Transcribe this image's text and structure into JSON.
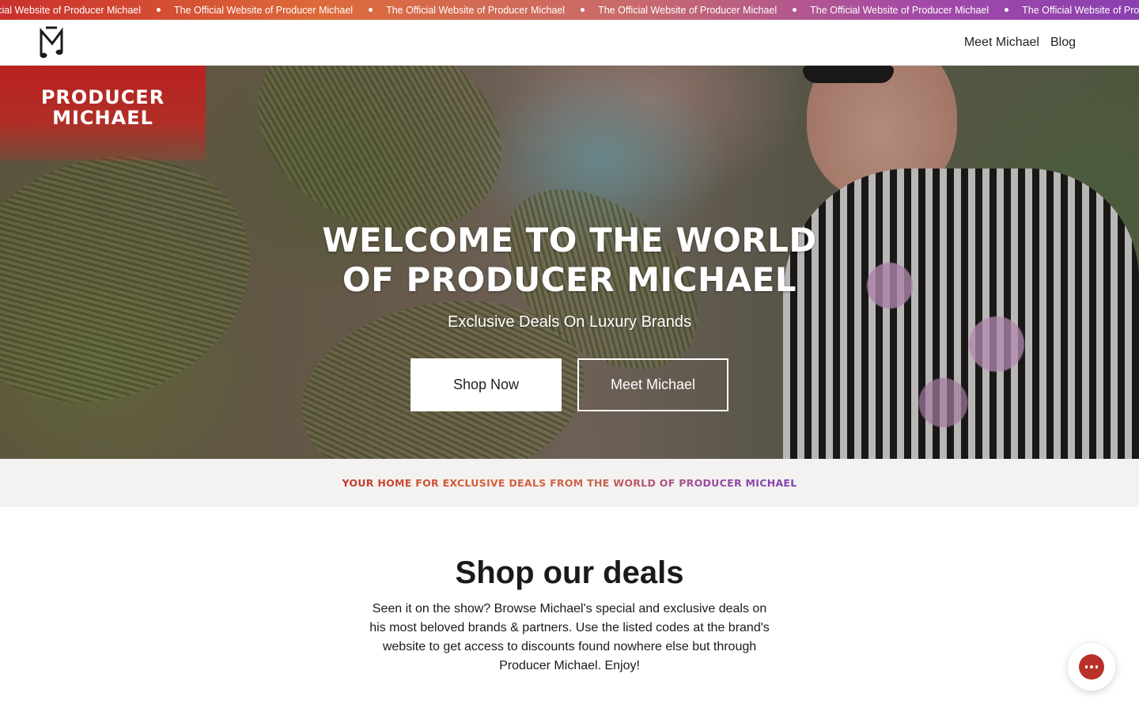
{
  "announcement": {
    "text": "The Official Website of Producer Michael",
    "repeats": [
      "The Official Website of Producer Michael",
      "The Official Website of Producer Michael",
      "The Official Website of Producer Michael",
      "The Official Website of Producer Michael",
      "The Official Website of Producer Michael",
      "The Official Website of Producer Michael"
    ]
  },
  "header": {
    "logo_icon": "pm-music-note-monogram-icon",
    "nav": [
      {
        "label": "Meet Michael"
      },
      {
        "label": "Blog"
      }
    ]
  },
  "hero": {
    "brand_name": "PRODUCER\nMICHAEL",
    "title": "WELCOME TO THE WORLD\nOF PRODUCER MICHAEL",
    "subtitle": "Exclusive Deals On Luxury Brands",
    "primary_button": "Shop Now",
    "secondary_button": "Meet Michael"
  },
  "tagline": "YOUR HOME FOR EXCLUSIVE DEALS FROM THE WORLD OF PRODUCER MICHAEL",
  "deals": {
    "title": "Shop our deals",
    "body": "Seen it on the show? Browse Michael's special and exclusive deals on his most beloved brands & partners. Use the listed codes at the brand's website to get access to discounts found nowhere else but through Producer Michael. Enjoy!"
  },
  "chat": {
    "icon": "chat-bubble-ellipsis-icon"
  },
  "colors": {
    "brand_red": "#b9302a",
    "gradient_start": "#c9302c",
    "gradient_mid": "#dd6a3a",
    "gradient_end": "#8a3fb0",
    "tagline_bg": "#f3f2f0"
  }
}
